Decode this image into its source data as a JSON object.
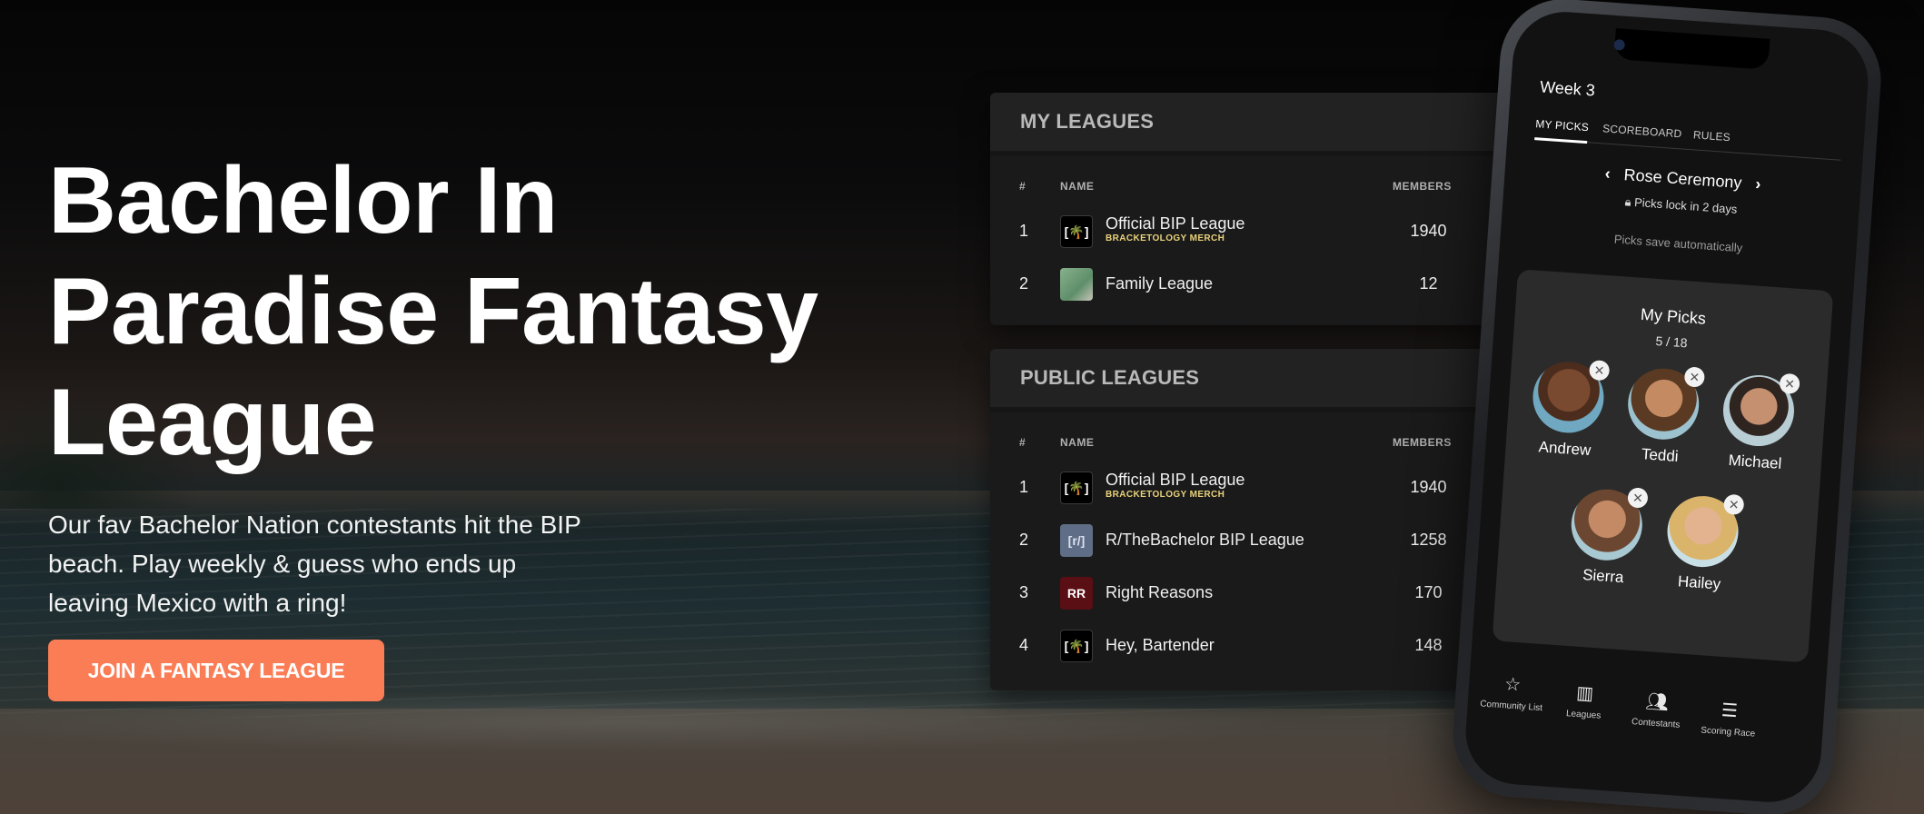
{
  "hero": {
    "title": "Bachelor In Paradise Fantasy League",
    "subtitle": "Our fav Bachelor Nation contestants hit the BIP beach. Play weekly & guess who ends up leaving Mexico with a ring!",
    "cta_label": "JOIN A FANTASY LEAGUE"
  },
  "colors": {
    "accent": "#fb7d55",
    "panel_bg": "#1a1a1a",
    "merch_label": "#e9d27a"
  },
  "my_leagues": {
    "title": "MY LEAGUES",
    "columns": {
      "num": "#",
      "name": "NAME",
      "members": "MEMBERS"
    },
    "rows": [
      {
        "num": "1",
        "name": "Official BIP League",
        "sub": "BRACKETOLOGY MERCH",
        "members": "1940",
        "logo_icon": "palm-tree-bracket-icon"
      },
      {
        "num": "2",
        "name": "Family League",
        "members": "12",
        "logo_icon": "cat-photo-icon"
      }
    ]
  },
  "public_leagues": {
    "title": "PUBLIC LEAGUES",
    "columns": {
      "num": "#",
      "name": "NAME",
      "members": "MEMBERS"
    },
    "rows": [
      {
        "num": "1",
        "name": "Official BIP League",
        "sub": "BRACKETOLOGY MERCH",
        "members": "1940",
        "logo_icon": "palm-tree-bracket-icon"
      },
      {
        "num": "2",
        "name": "R/TheBachelor BIP League",
        "members": "1258",
        "logo_text": "[r/]"
      },
      {
        "num": "3",
        "name": "Right Reasons",
        "members": "170",
        "logo_text": "RR"
      },
      {
        "num": "4",
        "name": "Hey, Bartender",
        "members": "148",
        "logo_icon": "palm-tree-bracket-icon"
      }
    ]
  },
  "phone": {
    "week": "Week 3",
    "tabs": [
      "MY PICKS",
      "SCOREBOARD",
      "RULES"
    ],
    "section": "Rose Ceremony",
    "lock_text": "Picks lock in 2 days",
    "save_text": "Picks save automatically",
    "picks_title": "My Picks",
    "picks_count": "5 / 18",
    "picks": [
      "Andrew",
      "Teddi",
      "Michael",
      "Sierra",
      "Hailey"
    ],
    "nav": [
      {
        "label": "Community List",
        "icon": "star-person-icon"
      },
      {
        "label": "Leagues",
        "icon": "bar-chart-icon"
      },
      {
        "label": "Contestants",
        "icon": "people-icon"
      },
      {
        "label": "Scoring Race",
        "icon": "list-check-icon"
      }
    ]
  }
}
